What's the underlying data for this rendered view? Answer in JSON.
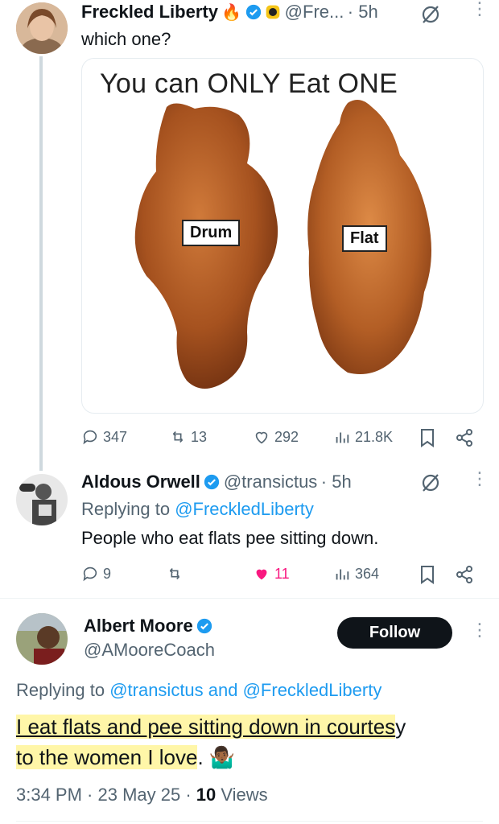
{
  "tweet1": {
    "name": "Freckled Liberty",
    "emoji_badges": "🔥",
    "handle": "@Fre...",
    "time": "· 5h",
    "text": "which one?",
    "media": {
      "title": "You can ONLY Eat ONE",
      "label_left": "Drum",
      "label_right": "Flat"
    },
    "stats": {
      "replies": "347",
      "reposts": "13",
      "likes": "292",
      "views": "21.8K"
    }
  },
  "reply1": {
    "name": "Aldous Orwell",
    "handle": "@transictus",
    "time": "· 5h",
    "replying_prefix": "Replying to ",
    "replying_to": "@FreckledLiberty",
    "text": "People who eat flats pee sitting down.",
    "stats": {
      "replies": "9",
      "reposts": "",
      "likes": "11",
      "views": "364"
    },
    "like_color": "#f91880"
  },
  "reply2": {
    "name": "Albert Moore",
    "handle": "@AMooreCoach",
    "follow_label": "Follow",
    "replying_prefix": "Replying to ",
    "replying_to": "@transictus and @FreckledLiberty",
    "text_line1_highlighted": "I eat flats and pee sitting down in courtes",
    "text_line1_rest": "y",
    "text_line2_highlighted": "to the women I love",
    "text_line2_rest": ". 🤷🏾‍♂️",
    "timestamp": "3:34 PM · 23 May 25 · ",
    "views_count": "10",
    "views_label": " Views"
  },
  "colors": {
    "accent": "#1d9bf0",
    "muted": "#536471",
    "like_active": "#f91880",
    "highlight": "#fff6a8"
  }
}
